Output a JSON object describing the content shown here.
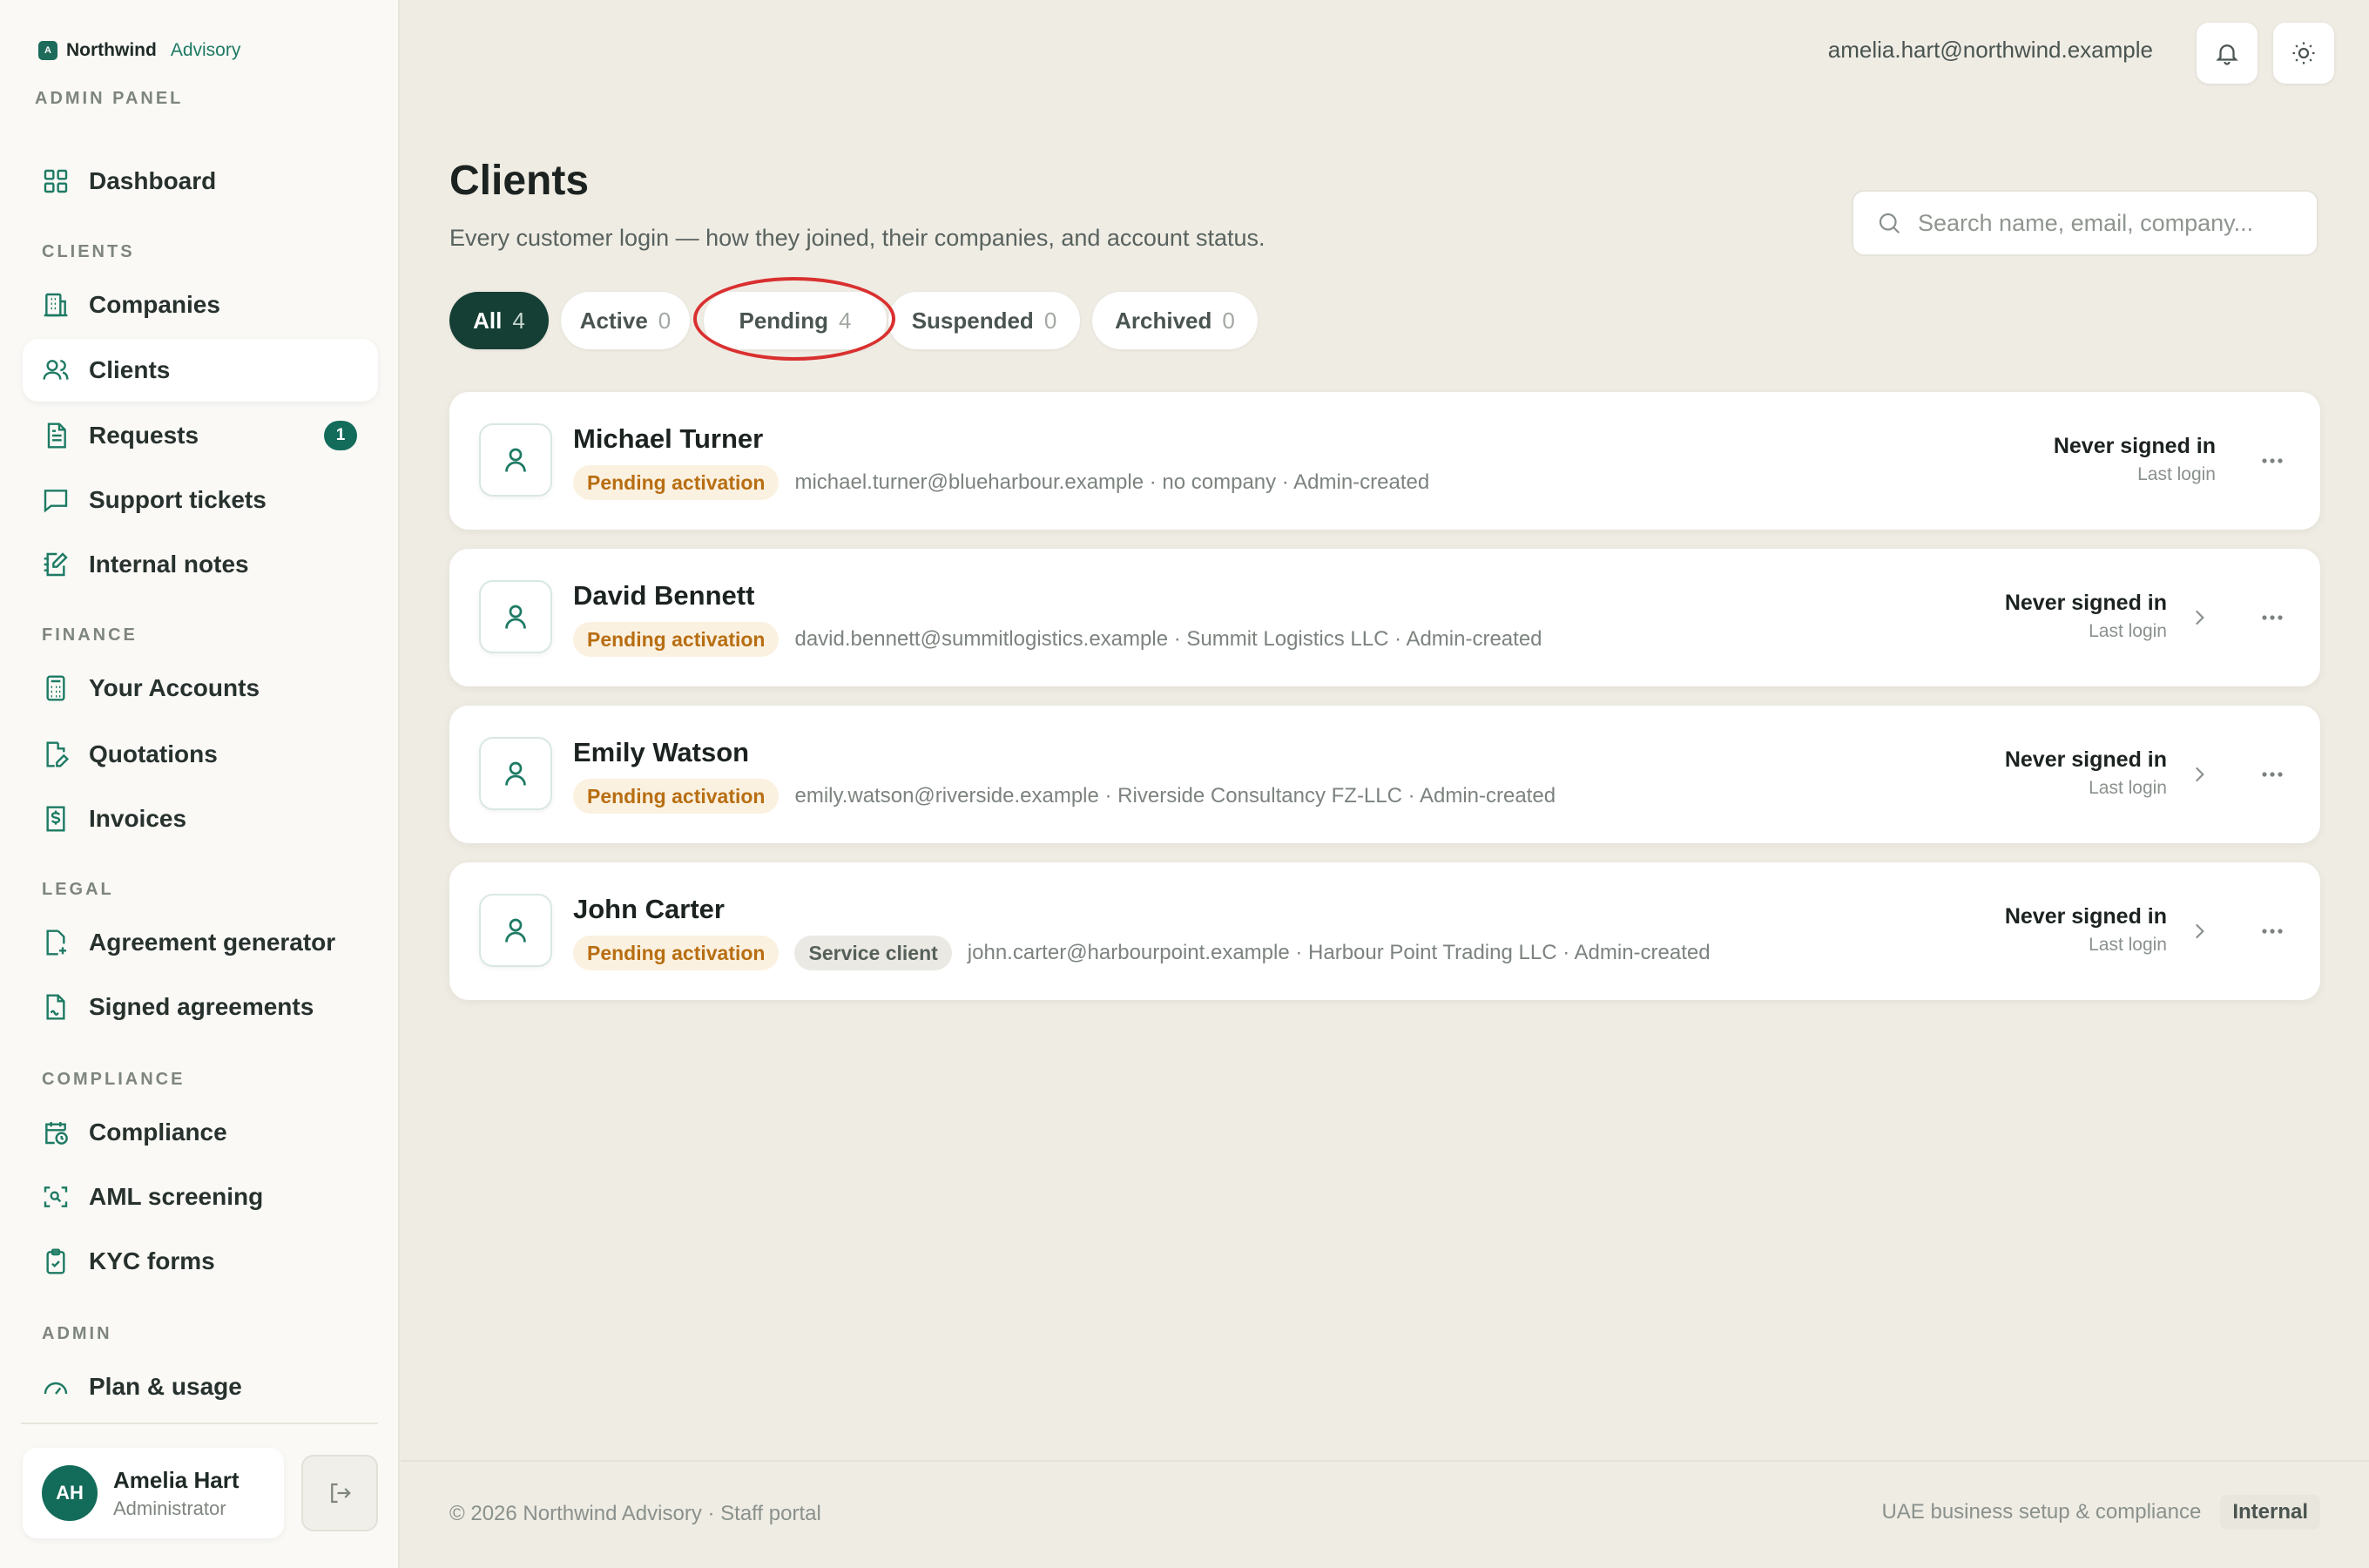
{
  "brand": {
    "name": "Northwind",
    "accent": "Advisory",
    "logo_letter": "A",
    "panel_label": "ADMIN PANEL"
  },
  "sidebar": {
    "dashboard": "Dashboard",
    "sections": {
      "clients": "CLIENTS",
      "finance": "FINANCE",
      "legal": "LEGAL",
      "compliance": "COMPLIANCE",
      "admin": "ADMIN"
    },
    "items": {
      "companies": "Companies",
      "clients": "Clients",
      "requests": "Requests",
      "requests_badge": "1",
      "support_tickets": "Support tickets",
      "internal_notes": "Internal notes",
      "your_accounts": "Your Accounts",
      "quotations": "Quotations",
      "invoices": "Invoices",
      "agreement_generator": "Agreement generator",
      "signed_agreements": "Signed agreements",
      "compliance": "Compliance",
      "aml_screening": "AML screening",
      "kyc_forms": "KYC forms",
      "plan_usage": "Plan & usage"
    },
    "user": {
      "initials": "AH",
      "name": "Amelia Hart",
      "role": "Administrator"
    }
  },
  "topbar": {
    "email": "amelia.hart@northwind.example"
  },
  "page": {
    "title": "Clients",
    "subtitle": "Every customer login — how they joined, their companies, and account status.",
    "search_placeholder": "Search name, email, company..."
  },
  "tabs": [
    {
      "label": "All",
      "count": "4"
    },
    {
      "label": "Active",
      "count": "0"
    },
    {
      "label": "Pending",
      "count": "4"
    },
    {
      "label": "Suspended",
      "count": "0"
    },
    {
      "label": "Archived",
      "count": "0"
    }
  ],
  "clients": [
    {
      "name": "Michael Turner",
      "status_badge": "Pending activation",
      "details": "michael.turner@blueharbour.example · no company · Admin-created",
      "login_status": "Never signed in",
      "login_label": "Last login"
    },
    {
      "name": "David Bennett",
      "status_badge": "Pending activation",
      "details": "david.bennett@summitlogistics.example · Summit Logistics LLC · Admin-created",
      "login_status": "Never signed in",
      "login_label": "Last login"
    },
    {
      "name": "Emily Watson",
      "status_badge": "Pending activation",
      "details": "emily.watson@riverside.example · Riverside Consultancy FZ-LLC · Admin-created",
      "login_status": "Never signed in",
      "login_label": "Last login"
    },
    {
      "name": "John Carter",
      "status_badge": "Pending activation",
      "extra_badge": "Service client",
      "details": "john.carter@harbourpoint.example · Harbour Point Trading LLC · Admin-created",
      "login_status": "Never signed in",
      "login_label": "Last login"
    }
  ],
  "footer": {
    "left": "© 2026 Northwind Advisory · Staff portal",
    "right": "UAE business setup & compliance",
    "tag": "Internal"
  },
  "colors": {
    "accent": "#1d7a63",
    "dark_green": "#153f34",
    "pending": "#b86e12",
    "annotation": "#d9302f"
  }
}
